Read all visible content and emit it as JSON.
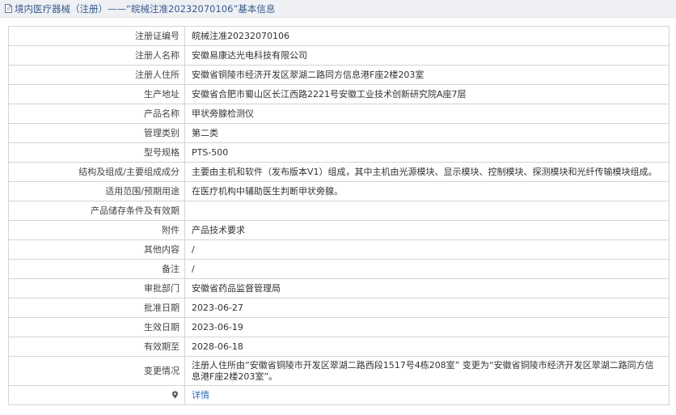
{
  "header": {
    "title": "境内医疗器械（注册）——“皖械注准20232070106”基本信息",
    "icon": "document-icon"
  },
  "rows": [
    {
      "label": "注册证编号",
      "value": "皖械注准20232070106"
    },
    {
      "label": "注册人名称",
      "value": "安徽易康达光电科技有限公司"
    },
    {
      "label": "注册人住所",
      "value": "安徽省铜陵市经济开发区翠湖二路同方信息港F座2楼203室"
    },
    {
      "label": "生产地址",
      "value": "安徽省合肥市蜀山区长江西路2221号安徽工业技术创新研究院A座7层"
    },
    {
      "label": "产品名称",
      "value": "甲状旁腺检测仪"
    },
    {
      "label": "管理类别",
      "value": "第二类"
    },
    {
      "label": "型号规格",
      "value": "PTS-500"
    },
    {
      "label": "结构及组成/主要组成成分",
      "value": "主要由主机和软件（发布版本V1）组成，其中主机由光源模块、显示模块、控制模块、探测模块和光纤传输模块组成。"
    },
    {
      "label": "适用范围/预期用途",
      "value": "在医疗机构中辅助医生判断甲状旁腺。"
    },
    {
      "label": "产品储存条件及有效期",
      "value": ""
    },
    {
      "label": "附件",
      "value": "产品技术要求"
    },
    {
      "label": "其他内容",
      "value": "/"
    },
    {
      "label": "备注",
      "value": "/"
    },
    {
      "label": "审批部门",
      "value": "安徽省药品监督管理局"
    },
    {
      "label": "批准日期",
      "value": "2023-06-27"
    },
    {
      "label": "生效日期",
      "value": "2023-06-19"
    },
    {
      "label": "有效期至",
      "value": "2028-06-18"
    },
    {
      "label": "变更情况",
      "value": "注册人住所由“安徽省铜陵市开发区翠湖二路西段1517号4栋208室” 变更为“安徽省铜陵市经济开发区翠湖二路同方信息港F座2楼203室”。"
    }
  ],
  "footer_row": {
    "icon": "location-pin-icon",
    "link_label": "详情"
  },
  "colors": {
    "title_text": "#3a5a8c",
    "title_bg": "#eef0f4",
    "border": "#d4d4d4",
    "link": "#2a6fc0"
  }
}
